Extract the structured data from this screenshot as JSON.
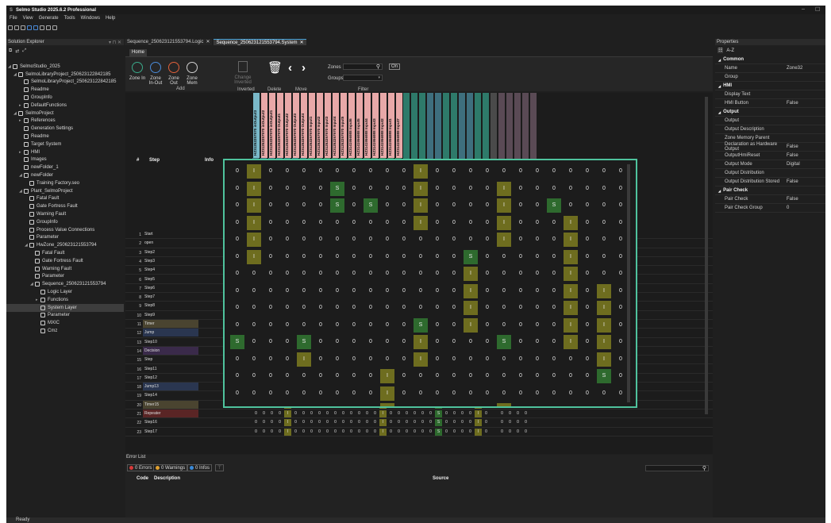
{
  "app": {
    "title": "Selmo Studio 2025.6.2 Professional",
    "logo": "S"
  },
  "menu": [
    "File",
    "View",
    "Generate",
    "Tools",
    "Windows",
    "Help"
  ],
  "solution_explorer": {
    "title": "Solution Explorer",
    "pin_glyphs": "▾ ⊓ ✕",
    "tree": [
      {
        "label": "SelmoStudio_2025",
        "indent": 0,
        "arrow": "◢",
        "icon": "solution-icon"
      },
      {
        "label": "SelmoLibraryProject_250623122842185",
        "indent": 1,
        "arrow": "◢",
        "icon": "project-icon"
      },
      {
        "label": "SelmoLibraryProject_250623122842185",
        "indent": 2,
        "arrow": "",
        "icon": "file-icon"
      },
      {
        "label": "Readme",
        "indent": 2,
        "arrow": "",
        "icon": "file-icon"
      },
      {
        "label": "GroupInfo",
        "indent": 2,
        "arrow": "",
        "icon": "list-icon"
      },
      {
        "label": "DefaultFunctions",
        "indent": 2,
        "arrow": "▸",
        "icon": "function-icon"
      },
      {
        "label": "SelmoProject",
        "indent": 1,
        "arrow": "◢",
        "icon": "project-icon"
      },
      {
        "label": "References",
        "indent": 2,
        "arrow": "▸",
        "icon": "reference-icon"
      },
      {
        "label": "Generation Settings",
        "indent": 2,
        "arrow": "",
        "icon": "gear-icon"
      },
      {
        "label": "Readme",
        "indent": 2,
        "arrow": "",
        "icon": "file-icon"
      },
      {
        "label": "Target System",
        "indent": 2,
        "arrow": "",
        "icon": "target-icon"
      },
      {
        "label": "HMI",
        "indent": 2,
        "arrow": "▸",
        "icon": "hmi-icon"
      },
      {
        "label": "Images",
        "indent": 2,
        "arrow": "",
        "icon": "image-icon"
      },
      {
        "label": "newFolder_1",
        "indent": 2,
        "arrow": "",
        "icon": "folder-icon"
      },
      {
        "label": "newFolder",
        "indent": 2,
        "arrow": "◢",
        "icon": "folder-icon"
      },
      {
        "label": "Training Factory.seo",
        "indent": 3,
        "arrow": "",
        "icon": "file-icon"
      },
      {
        "label": "Plant_SelmoProject",
        "indent": 2,
        "arrow": "◢",
        "icon": "plant-icon"
      },
      {
        "label": "Fatal Fault",
        "indent": 3,
        "arrow": "",
        "icon": "fault-icon"
      },
      {
        "label": "Gate Fortress Fault",
        "indent": 3,
        "arrow": "",
        "icon": "fault-icon"
      },
      {
        "label": "Warning Fault",
        "indent": 3,
        "arrow": "",
        "icon": "fault-icon"
      },
      {
        "label": "GroupInfo",
        "indent": 3,
        "arrow": "",
        "icon": "list-icon"
      },
      {
        "label": "Process Value Connections",
        "indent": 3,
        "arrow": "",
        "icon": "gear-icon"
      },
      {
        "label": "Parameter",
        "indent": 3,
        "arrow": "",
        "icon": "parameter-icon"
      },
      {
        "label": "HwZone_250623121553794",
        "indent": 3,
        "arrow": "◢",
        "icon": "zone-icon"
      },
      {
        "label": "Fatal Fault",
        "indent": 4,
        "arrow": "",
        "icon": "fault-icon"
      },
      {
        "label": "Gate Fortress Fault",
        "indent": 4,
        "arrow": "",
        "icon": "fault-icon"
      },
      {
        "label": "Warning Fault",
        "indent": 4,
        "arrow": "",
        "icon": "fault-icon"
      },
      {
        "label": "Parameter",
        "indent": 4,
        "arrow": "",
        "icon": "parameter-icon"
      },
      {
        "label": "Sequence_250623121553794",
        "indent": 4,
        "arrow": "◢",
        "icon": "zone-icon"
      },
      {
        "label": "Logic Layer",
        "indent": 5,
        "arrow": "",
        "icon": "logic-icon"
      },
      {
        "label": "Functions",
        "indent": 5,
        "arrow": "▸",
        "icon": "function-icon"
      },
      {
        "label": "System Layer",
        "indent": 5,
        "arrow": "",
        "icon": "grid-icon",
        "selected": true
      },
      {
        "label": "Parameter",
        "indent": 5,
        "arrow": "",
        "icon": "parameter-icon"
      },
      {
        "label": "MXIC",
        "indent": 5,
        "arrow": "",
        "icon": "link-icon"
      },
      {
        "label": "Cmz",
        "indent": 5,
        "arrow": "",
        "icon": "fault-icon"
      }
    ]
  },
  "doc_tabs": [
    {
      "label": "Sequence_250623121553794.Logic",
      "close": "✕",
      "active": false
    },
    {
      "label": "Sequence_250623121553794.System",
      "close": "✕",
      "active": true
    }
  ],
  "ribbon": {
    "tab": "Home",
    "buttons": [
      {
        "label": "Zone In",
        "color": "#3aaa8a"
      },
      {
        "label": "Zone In-Out",
        "color": "#4a8ad8"
      },
      {
        "label": "Zone Out",
        "color": "#e0603a"
      },
      {
        "label": "Zone Mem",
        "color": "#d0d0d0"
      }
    ],
    "group_add": "Add",
    "inverted_btn": "Change Inverted",
    "group_inverted": "Inverted",
    "delete_btn": "Delete",
    "group_delete": "Delete",
    "group_move": "Move",
    "zones_label": "Zones",
    "groups_label": "Groups",
    "on_label": "On",
    "group_filter": "Filter"
  },
  "grid": {
    "col_num": "#",
    "col_step": "Step",
    "col_info": "Info",
    "col_headers": [
      "HZ31252257970 inOutput3",
      "HZ31252257970 inOutput2",
      "HZ31252257970 inOutput1",
      "HZ31252257970 Output1",
      "HZ31252257970 Output2",
      "HZ31252257970 Output3",
      "HZ31252257970 Output4",
      "HZ31252257970 Input1",
      "HZ31252257970 Input2",
      "HZ31252257970 Input3",
      "HZ31252257970 Input4",
      "HZ31252257970 Input5",
      "HZ3141956988 Input6",
      "HZ3141956988 Input5",
      "HZ3141956988 Input4",
      "HZ3141956988 Input3",
      "HZ3141956988 Input2",
      "HZ3141956988 Input1",
      "HZ3141956988 Input7"
    ],
    "zone_labels": [
      "Zone33",
      "Zone34",
      "Zone35",
      "Reset"
    ],
    "steps": [
      {
        "n": "1",
        "name": "Start",
        "type": "step"
      },
      {
        "n": "2",
        "name": "open",
        "type": "step"
      },
      {
        "n": "3",
        "name": "Step2",
        "type": "step"
      },
      {
        "n": "4",
        "name": "Step3",
        "type": "step"
      },
      {
        "n": "5",
        "name": "Step4",
        "type": "step"
      },
      {
        "n": "6",
        "name": "Step5",
        "type": "step"
      },
      {
        "n": "7",
        "name": "Step6",
        "type": "step"
      },
      {
        "n": "8",
        "name": "Step7",
        "type": "step"
      },
      {
        "n": "9",
        "name": "Step8",
        "type": "step"
      },
      {
        "n": "10",
        "name": "Step9",
        "type": "step"
      },
      {
        "n": "11",
        "name": "Timer",
        "type": "timer"
      },
      {
        "n": "12",
        "name": "Jump",
        "type": "jump"
      },
      {
        "n": "13",
        "name": "Step10",
        "type": "step"
      },
      {
        "n": "14",
        "name": "Decision",
        "type": "decision"
      },
      {
        "n": "15",
        "name": "Step",
        "type": "step"
      },
      {
        "n": "16",
        "name": "Step11",
        "type": "step"
      },
      {
        "n": "17",
        "name": "Step12",
        "type": "step"
      },
      {
        "n": "18",
        "name": "Jump13",
        "type": "jump"
      },
      {
        "n": "19",
        "name": "Step14",
        "type": "step"
      },
      {
        "n": "20",
        "name": "Timer15",
        "type": "timer"
      },
      {
        "n": "21",
        "name": "Repeater",
        "type": "repeater"
      },
      {
        "n": "22",
        "name": "Step16",
        "type": "step"
      },
      {
        "n": "23",
        "name": "Step17",
        "type": "step"
      }
    ],
    "right_cols": [
      [
        "0",
        "0",
        "0",
        "0"
      ],
      [
        "0",
        "0",
        "0",
        "0"
      ],
      [
        "0",
        "0",
        "0",
        "0"
      ],
      [
        "0",
        "0",
        "0",
        "0"
      ],
      [
        "0",
        "0",
        "0",
        "0"
      ],
      [
        "0",
        "0",
        "M",
        "0"
      ],
      [
        "0",
        "0",
        "0",
        "0"
      ],
      [
        "0",
        "0",
        "0",
        "0"
      ],
      [
        "0",
        "0",
        "0",
        "0"
      ],
      [
        "0",
        "0",
        "0",
        "0"
      ],
      [
        "0",
        "0",
        "0",
        "0"
      ],
      [
        "0",
        "0",
        "0",
        "0"
      ],
      [
        "0",
        "0",
        "0",
        "M"
      ],
      [
        "0",
        "0",
        "0",
        "0"
      ],
      [
        "0",
        "0",
        "0",
        "0"
      ],
      [
        "0",
        "0",
        "0",
        "0"
      ],
      [
        "0",
        "0",
        "0",
        "0"
      ],
      [
        "0",
        "0",
        "0",
        "0"
      ],
      [
        "0",
        "0",
        "0",
        "0"
      ],
      [
        "0",
        "0",
        "0",
        "0"
      ],
      [
        "0",
        "0",
        "0",
        "0"
      ],
      [
        "0",
        "0",
        "0",
        "0"
      ],
      [
        "0",
        "0",
        "0",
        "0"
      ]
    ]
  },
  "overlay_rows": [
    [
      "0",
      "I",
      "0",
      "0",
      "0",
      "0",
      "0",
      "0",
      "0",
      "0",
      "0",
      "I",
      "0",
      "0",
      "0",
      "0",
      "0",
      "0",
      "0",
      "0",
      "0",
      "0",
      "0",
      "0"
    ],
    [
      "0",
      "I",
      "0",
      "0",
      "0",
      "0",
      "S",
      "0",
      "0",
      "0",
      "0",
      "I",
      "0",
      "0",
      "0",
      "0",
      "I",
      "0",
      "0",
      "0",
      "0",
      "0",
      "0",
      "0"
    ],
    [
      "0",
      "I",
      "0",
      "0",
      "0",
      "0",
      "S",
      "0",
      "S",
      "0",
      "0",
      "I",
      "0",
      "0",
      "0",
      "0",
      "I",
      "0",
      "0",
      "S",
      "0",
      "0",
      "0",
      "0"
    ],
    [
      "0",
      "I",
      "0",
      "0",
      "0",
      "0",
      "0",
      "0",
      "0",
      "0",
      "0",
      "I",
      "0",
      "0",
      "0",
      "0",
      "I",
      "0",
      "0",
      "0",
      "I",
      "0",
      "0",
      "0"
    ],
    [
      "0",
      "I",
      "0",
      "0",
      "0",
      "0",
      "0",
      "0",
      "0",
      "0",
      "0",
      "0",
      "0",
      "0",
      "0",
      "0",
      "I",
      "0",
      "0",
      "0",
      "I",
      "0",
      "0",
      "0"
    ],
    [
      "0",
      "I",
      "0",
      "0",
      "0",
      "0",
      "0",
      "0",
      "0",
      "0",
      "0",
      "0",
      "0",
      "0",
      "S",
      "0",
      "0",
      "0",
      "0",
      "0",
      "I",
      "0",
      "0",
      "0"
    ],
    [
      "0",
      "0",
      "0",
      "0",
      "0",
      "0",
      "0",
      "0",
      "0",
      "0",
      "0",
      "0",
      "0",
      "0",
      "I",
      "0",
      "0",
      "0",
      "0",
      "0",
      "I",
      "0",
      "0",
      "0"
    ],
    [
      "0",
      "0",
      "0",
      "0",
      "0",
      "0",
      "0",
      "0",
      "0",
      "0",
      "0",
      "0",
      "0",
      "0",
      "I",
      "0",
      "0",
      "0",
      "0",
      "0",
      "I",
      "0",
      "I",
      "0"
    ],
    [
      "0",
      "0",
      "0",
      "0",
      "0",
      "0",
      "0",
      "0",
      "0",
      "0",
      "0",
      "0",
      "0",
      "0",
      "I",
      "0",
      "0",
      "0",
      "0",
      "0",
      "I",
      "0",
      "I",
      "0"
    ],
    [
      "0",
      "0",
      "0",
      "0",
      "0",
      "0",
      "0",
      "0",
      "0",
      "0",
      "0",
      "S",
      "0",
      "0",
      "I",
      "0",
      "0",
      "0",
      "0",
      "0",
      "I",
      "0",
      "I",
      "0"
    ],
    [
      "S",
      "0",
      "0",
      "0",
      "S",
      "0",
      "0",
      "0",
      "0",
      "0",
      "0",
      "I",
      "0",
      "0",
      "0",
      "0",
      "S",
      "0",
      "0",
      "0",
      "I",
      "0",
      "I",
      "0"
    ],
    [
      "0",
      "0",
      "0",
      "0",
      "I",
      "0",
      "0",
      "0",
      "0",
      "0",
      "0",
      "I",
      "0",
      "0",
      "0",
      "0",
      "0",
      "0",
      "0",
      "0",
      "0",
      "0",
      "I",
      "0"
    ],
    [
      "0",
      "0",
      "0",
      "0",
      "0",
      "0",
      "0",
      "0",
      "0",
      "I",
      "0",
      "0",
      "0",
      "0",
      "0",
      "0",
      "0",
      "0",
      "0",
      "0",
      "0",
      "0",
      "S",
      "0"
    ],
    [
      "0",
      "0",
      "0",
      "0",
      "0",
      "0",
      "0",
      "0",
      "0",
      "I",
      "0",
      "0",
      "0",
      "0",
      "0",
      "0",
      "0",
      "0",
      "0",
      "0",
      "0",
      "0",
      "0",
      "0"
    ],
    [
      "0",
      "0",
      "0",
      "0",
      "0",
      "0",
      "0",
      "0",
      "0",
      "I",
      "0",
      "0",
      "0",
      "0",
      "0",
      "0",
      "I",
      "0",
      "0",
      "0",
      "0",
      "0",
      "0",
      "0"
    ],
    [
      "0",
      "0",
      "0",
      "0",
      "0",
      "0",
      "0",
      "0",
      "0",
      "I",
      "0",
      "0",
      "0",
      "0",
      "0",
      "0",
      "I",
      "0",
      "0",
      "0",
      "0",
      "0",
      "0",
      "0"
    ],
    [
      "0",
      "0",
      "0",
      "0",
      "0",
      "0",
      "0",
      "0",
      "0",
      "I",
      "0",
      "0",
      "0",
      "0",
      "0",
      "0",
      "I",
      "0",
      "0",
      "0",
      "0",
      "0",
      "0",
      "0"
    ],
    [
      "0",
      "0",
      "0",
      "0",
      "I",
      "0",
      "0",
      "0",
      "0",
      "I",
      "0",
      "0",
      "0",
      "0",
      "0",
      "0",
      "I",
      "0",
      "I",
      "0",
      "0",
      "0",
      "0",
      "0"
    ],
    [
      "0",
      "0",
      "0",
      "0",
      "I",
      "0",
      "0",
      "0",
      "0",
      "I",
      "0",
      "0",
      "0",
      "0",
      "0",
      "0",
      "I",
      "0",
      "0",
      "0",
      "0",
      "0",
      "0",
      "0"
    ],
    [
      "0",
      "0",
      "0",
      "0",
      "I",
      "0",
      "0",
      "0",
      "0",
      "0",
      "0",
      "0",
      "0",
      "0",
      "0",
      "0",
      "I",
      "0",
      "0",
      "0",
      "0",
      "0",
      "0",
      "S"
    ]
  ],
  "properties": {
    "title": "Properties",
    "sort_az": "A-Z",
    "sort_cat": "☷",
    "sections": [
      {
        "name": "Common",
        "rows": [
          {
            "k": "Name",
            "v": "Zone32"
          },
          {
            "k": "Group",
            "v": ""
          }
        ]
      },
      {
        "name": "HMI",
        "rows": [
          {
            "k": "Display Text",
            "v": ""
          },
          {
            "k": "HMI Button",
            "v": "False"
          }
        ]
      },
      {
        "name": "Output",
        "rows": [
          {
            "k": "Output",
            "v": ""
          },
          {
            "k": "Output Description",
            "v": ""
          },
          {
            "k": "Zone Memory Parent",
            "v": ""
          },
          {
            "k": "Declaration as Hardware Output",
            "v": "False"
          },
          {
            "k": "OutputHmiReset",
            "v": "False"
          },
          {
            "k": "Output Mode",
            "v": "Digital"
          },
          {
            "k": "Output Distribution",
            "v": ""
          },
          {
            "k": "Output Distribution Stored",
            "v": "False"
          }
        ]
      },
      {
        "name": "Pair Check",
        "rows": [
          {
            "k": "Pair Check",
            "v": "False"
          },
          {
            "k": "Pair Check Group",
            "v": "0"
          }
        ]
      }
    ]
  },
  "error_list": {
    "title": "Error List",
    "errors": "0 Errors",
    "warnings": "0 Warnings",
    "infos": "0 Infos",
    "col_code": "Code",
    "col_desc": "Description",
    "col_source": "Source",
    "search_icon": "⚲"
  },
  "status": "Ready",
  "colors": {
    "accent": "#4fc39d",
    "olive": "#6e6d1f",
    "green": "#2e6a2e",
    "orange": "#c8780f"
  }
}
